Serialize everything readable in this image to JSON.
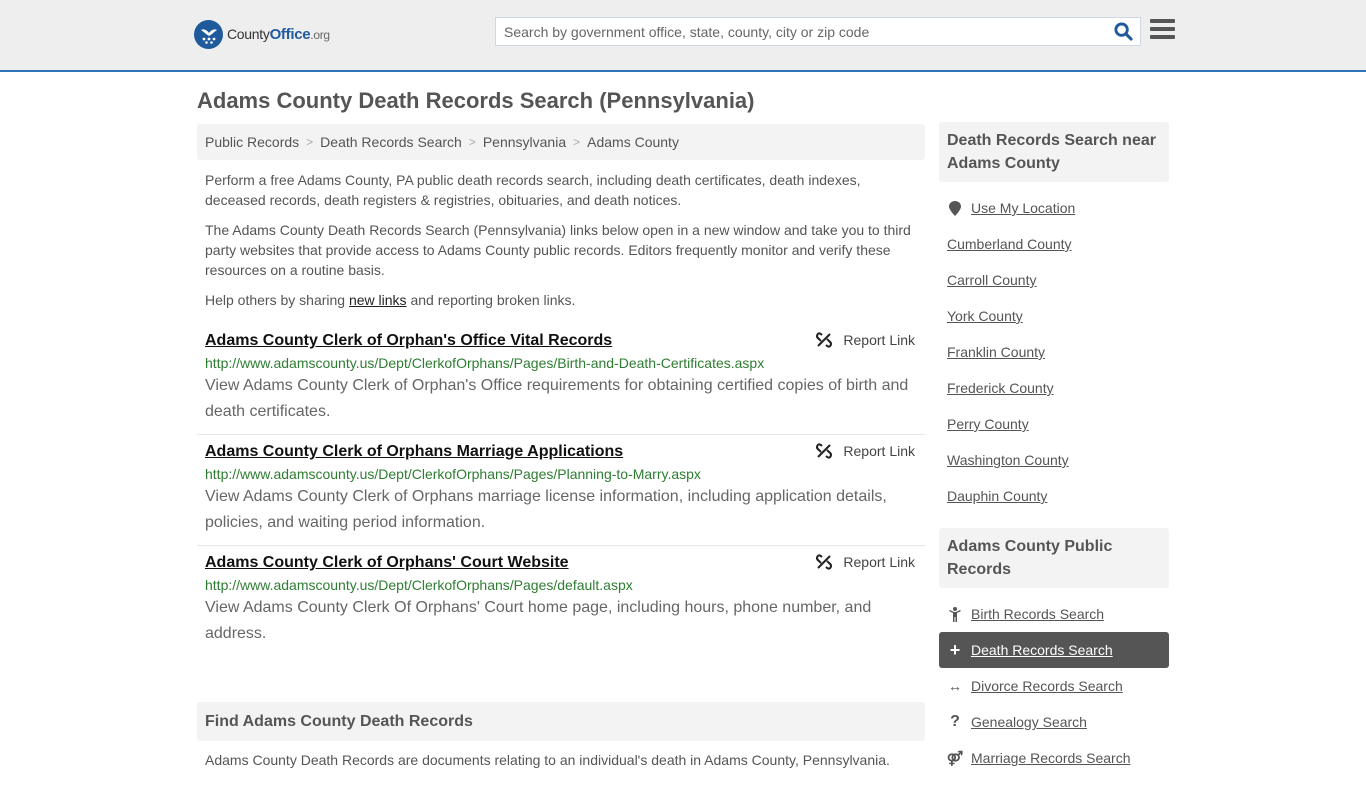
{
  "header": {
    "logo": {
      "name": "County",
      "name_accent": "Office",
      "tld": ".org"
    },
    "search": {
      "placeholder": "Search by government office, state, county, city or zip code",
      "value": ""
    },
    "icons": {
      "search": "search-icon",
      "menu": "hamburger-menu-icon"
    }
  },
  "page": {
    "title": "Adams County Death Records Search (Pennsylvania)"
  },
  "breadcrumb": [
    {
      "label": "Public Records"
    },
    {
      "label": "Death Records Search"
    },
    {
      "label": "Pennsylvania"
    },
    {
      "label": "Adams County"
    }
  ],
  "intro": {
    "p1": "Perform a free Adams County, PA public death records search, including death certificates, death indexes, deceased records, death registers & registries, obituaries, and death notices.",
    "p2": "The Adams County Death Records Search (Pennsylvania) links below open in a new window and take you to third party websites that provide access to Adams County public records. Editors frequently monitor and verify these resources on a routine basis.",
    "p3_before": "Help others by sharing ",
    "p3_link": "new links",
    "p3_after": " and reporting broken links."
  },
  "results": [
    {
      "title": "Adams County Clerk of Orphan's Office Vital Records",
      "url": "http://www.adamscounty.us/Dept/ClerkofOrphans/Pages/Birth-and-Death-Certificates.aspx",
      "description": "View Adams County Clerk of Orphan's Office requirements for obtaining certified copies of birth and death certificates.",
      "report_label": "Report Link"
    },
    {
      "title": "Adams County Clerk of Orphans Marriage Applications",
      "url": "http://www.adamscounty.us/Dept/ClerkofOrphans/Pages/Planning-to-Marry.aspx",
      "description": "View Adams County Clerk of Orphans marriage license information, including application details, policies, and waiting period information.",
      "report_label": "Report Link"
    },
    {
      "title": "Adams County Clerk of Orphans' Court Website",
      "url": "http://www.adamscounty.us/Dept/ClerkofOrphans/Pages/default.aspx",
      "description": "View Adams County Clerk Of Orphans' Court home page, including hours, phone number, and address.",
      "report_label": "Report Link"
    }
  ],
  "find_section": {
    "heading": "Find Adams County Death Records",
    "text": "Adams County Death Records are documents relating to an individual's death in Adams County, Pennsylvania."
  },
  "sidebar": {
    "nearby": {
      "heading": "Death Records Search near Adams County",
      "use_location": "Use My Location",
      "items": [
        "Cumberland County",
        "Carroll County",
        "York County",
        "Franklin County",
        "Frederick County",
        "Perry County",
        "Washington County",
        "Dauphin County"
      ]
    },
    "public_records": {
      "heading": "Adams County Public Records",
      "items": [
        {
          "label": "Birth Records Search",
          "icon": "child-icon",
          "glyph": "",
          "active": false
        },
        {
          "label": "Death Records Search",
          "icon": "plus-icon",
          "glyph": "+",
          "active": true
        },
        {
          "label": "Divorce Records Search",
          "icon": "arrows-horizontal-icon",
          "glyph": "↔",
          "active": false
        },
        {
          "label": "Genealogy Search",
          "icon": "question-icon",
          "glyph": "?",
          "active": false
        },
        {
          "label": "Marriage Records Search",
          "icon": "marriage-icon",
          "glyph": "⚤",
          "active": false
        }
      ]
    }
  },
  "colors": {
    "brand_blue": "#1e5a9c",
    "header_border": "#2f75b5",
    "url_green": "#2e7d32",
    "active_item_bg": "#555555"
  }
}
